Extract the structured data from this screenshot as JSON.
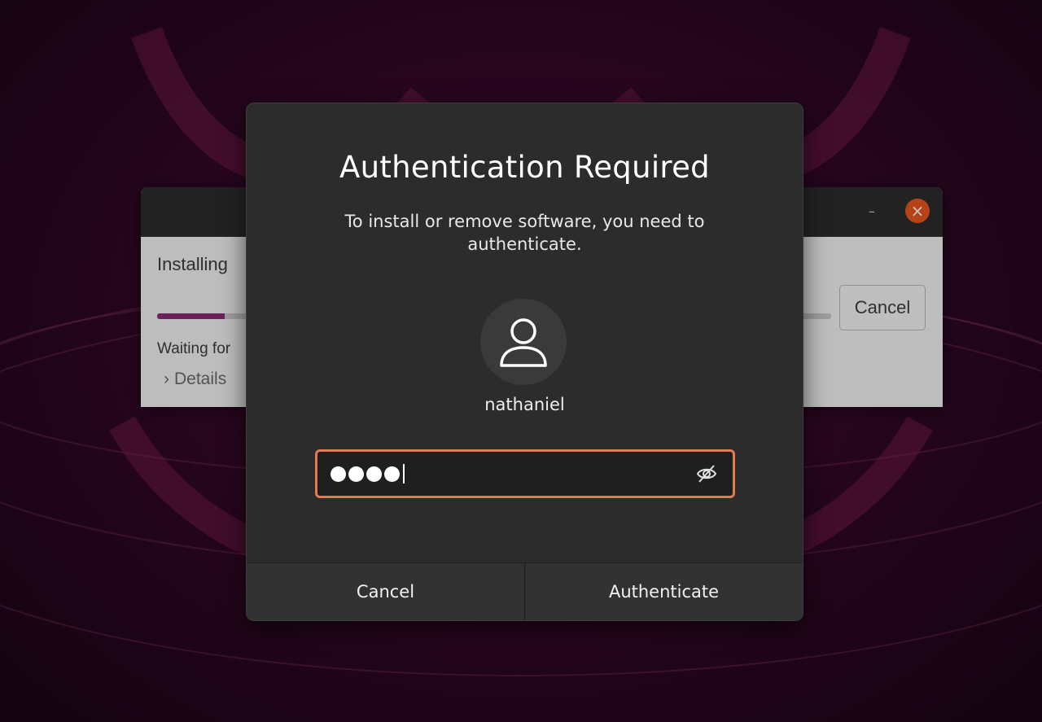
{
  "background_window": {
    "heading": "Installing",
    "progress": 0.1,
    "status": "Waiting for",
    "details_label": "Details",
    "cancel_label": "Cancel",
    "minimize_glyph": "–",
    "close_glyph": "×"
  },
  "dialog": {
    "title": "Authentication Required",
    "message": "To install or remove software, you need to authenticate.",
    "username": "nathaniel",
    "password_masked_length": 4,
    "buttons": {
      "cancel_label": "Cancel",
      "authenticate_label": "Authenticate"
    }
  },
  "colors": {
    "accent": "#e47952",
    "close_button": "#e9541f",
    "progress": "#8a2a74"
  },
  "icons": {
    "avatar": "user-icon",
    "reveal": "eye-slash-icon",
    "details": "chevron-right-icon"
  }
}
